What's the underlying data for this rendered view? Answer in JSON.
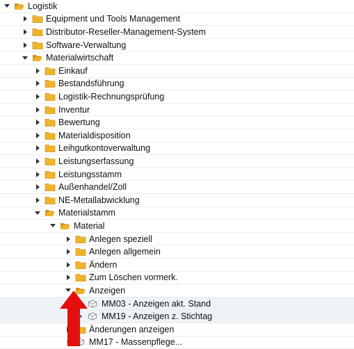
{
  "tree": {
    "items": [
      {
        "label": "Logistik",
        "level": 0,
        "type": "folder",
        "expanded": true
      },
      {
        "label": "Equipment und Tools Management",
        "level": 1,
        "type": "folder",
        "expanded": false
      },
      {
        "label": "Distributor-Reseller-Management-System",
        "level": 1,
        "type": "folder",
        "expanded": false
      },
      {
        "label": "Software-Verwaltung",
        "level": 1,
        "type": "folder",
        "expanded": false
      },
      {
        "label": "Materialwirtschaft",
        "level": 1,
        "type": "folder",
        "expanded": true
      },
      {
        "label": "Einkauf",
        "level": 2,
        "type": "folder",
        "expanded": false
      },
      {
        "label": "Bestandsführung",
        "level": 2,
        "type": "folder",
        "expanded": false
      },
      {
        "label": "Logistik-Rechnungsprüfung",
        "level": 2,
        "type": "folder",
        "expanded": false
      },
      {
        "label": "Inventur",
        "level": 2,
        "type": "folder",
        "expanded": false
      },
      {
        "label": "Bewertung",
        "level": 2,
        "type": "folder",
        "expanded": false
      },
      {
        "label": "Materialdisposition",
        "level": 2,
        "type": "folder",
        "expanded": false
      },
      {
        "label": "Leihgutkontoverwaltung",
        "level": 2,
        "type": "folder",
        "expanded": false
      },
      {
        "label": "Leistungserfassung",
        "level": 2,
        "type": "folder",
        "expanded": false
      },
      {
        "label": "Leistungsstamm",
        "level": 2,
        "type": "folder",
        "expanded": false
      },
      {
        "label": "Außenhandel/Zoll",
        "level": 2,
        "type": "folder",
        "expanded": false
      },
      {
        "label": "NE-Metallabwicklung",
        "level": 2,
        "type": "folder",
        "expanded": false
      },
      {
        "label": "Materialstamm",
        "level": 2,
        "type": "folder",
        "expanded": true
      },
      {
        "label": "Material",
        "level": 3,
        "type": "folder",
        "expanded": true
      },
      {
        "label": "Anlegen speziell",
        "level": 4,
        "type": "folder",
        "expanded": false
      },
      {
        "label": "Anlegen allgemein",
        "level": 4,
        "type": "folder",
        "expanded": false
      },
      {
        "label": "Ändern",
        "level": 4,
        "type": "folder",
        "expanded": false
      },
      {
        "label": "Zum Löschen vormerk.",
        "level": 4,
        "type": "folder",
        "expanded": false
      },
      {
        "label": "Anzeigen",
        "level": 4,
        "type": "folder",
        "expanded": true
      },
      {
        "label": "MM03 - Anzeigen akt. Stand",
        "level": 5,
        "type": "transaction",
        "highlight": true
      },
      {
        "label": "MM19 - Anzeigen z. Stichtag",
        "level": 5,
        "type": "transaction",
        "highlight": true
      },
      {
        "label": "Änderungen anzeigen",
        "level": 4,
        "type": "folder",
        "expanded": false
      },
      {
        "label": "MM17 - Massenpflege...",
        "level": 4,
        "type": "transaction"
      }
    ]
  },
  "colors": {
    "folder": "#f0b429",
    "folder_dark": "#d4931a",
    "arrow": "#e3100f",
    "row_highlight": "#eef3f8"
  }
}
